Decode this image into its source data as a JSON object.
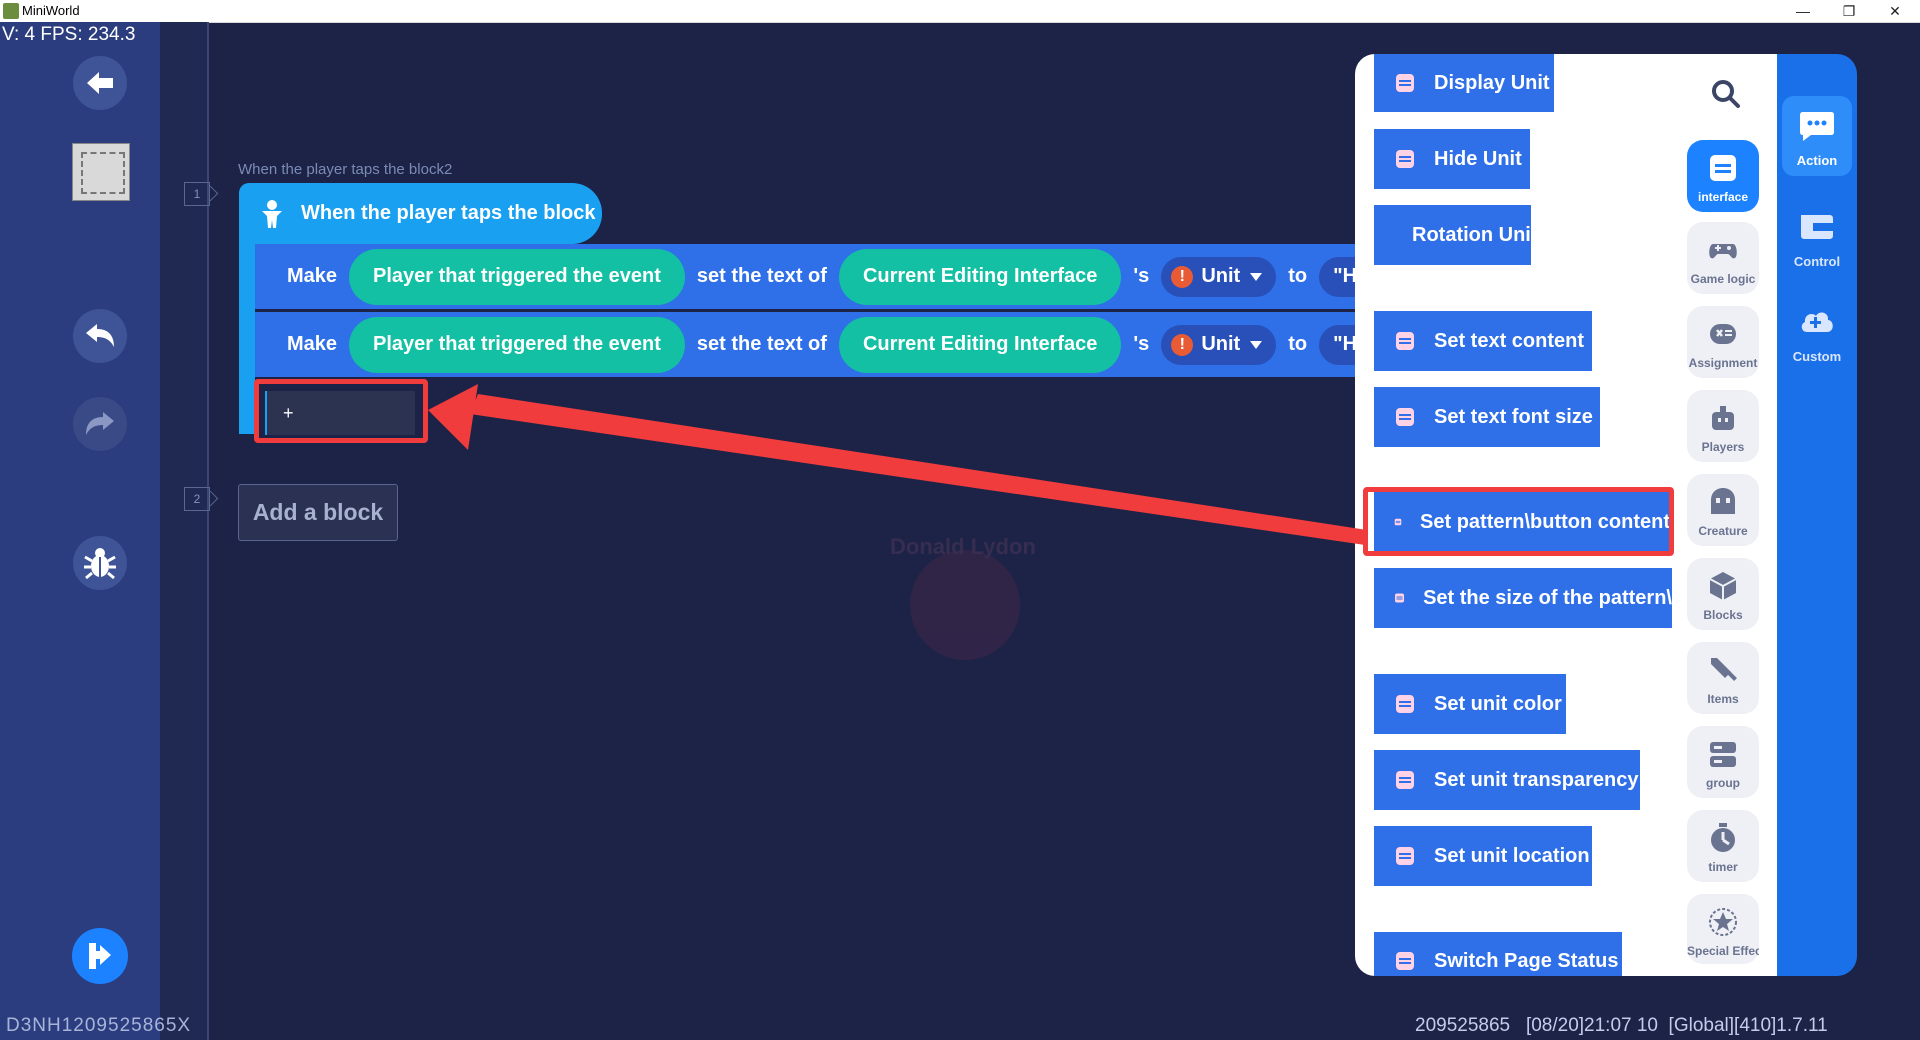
{
  "window": {
    "title": "MiniWorld",
    "minimize": "—",
    "maximize": "❐",
    "close": "✕"
  },
  "hud": {
    "fps": "V: 4 FPS: 234.3",
    "bottom_left": "D3NH1209525865X",
    "bottom_right": "209525865   [08/20]21:07 10  [Global][410]1.7.11"
  },
  "left_toolbar": {
    "icons": [
      "back-arrow-icon",
      "map-thumbnail",
      "undo-icon",
      "redo-icon",
      "bug-icon",
      "run-icon"
    ]
  },
  "watermark": {
    "text": "Donald Lydon"
  },
  "script": {
    "event_label": "When the player taps the block2",
    "line1": "1",
    "line2": "2",
    "event_block": "When the player taps the block",
    "rows": [
      {
        "make": "Make",
        "player": "Player that triggered the event",
        "set_text": "set the text of",
        "interface": "Current Editing Interface",
        "poss": "'s",
        "unit": "Unit",
        "to": "to",
        "value": "\"Hell"
      },
      {
        "make": "Make",
        "player": "Player that triggered the event",
        "set_text": "set the text of",
        "interface": "Current Editing Interface",
        "poss": "'s",
        "unit": "Unit",
        "to": "to",
        "value": "\"Hell"
      }
    ],
    "add_slot": "+",
    "add_block": "Add a block"
  },
  "block_list": {
    "items": [
      "Display Unit",
      "Hide Unit",
      "Rotation Unit",
      "Set text content",
      "Set text font size",
      "Set pattern\\button content",
      "Set the size of the pattern\\",
      "Set unit color",
      "Set unit transparency",
      "Set unit location",
      "Switch Page Status"
    ]
  },
  "categories": [
    {
      "label": "interface",
      "icon": "interface-icon",
      "active": true
    },
    {
      "label": "Game logic",
      "icon": "gamepad-icon"
    },
    {
      "label": "Assignment",
      "icon": "assignment-icon"
    },
    {
      "label": "Players",
      "icon": "player-icon"
    },
    {
      "label": "Creature",
      "icon": "creature-icon"
    },
    {
      "label": "Blocks",
      "icon": "cube-icon"
    },
    {
      "label": "Items",
      "icon": "sword-icon"
    },
    {
      "label": "group",
      "icon": "group-icon"
    },
    {
      "label": "timer",
      "icon": "timer-icon"
    },
    {
      "label": "Special Effect",
      "icon": "star-icon"
    }
  ],
  "nav": [
    {
      "label": "Action",
      "icon": "chat-bubble-icon",
      "active": true
    },
    {
      "label": "Control",
      "icon": "control-icon"
    },
    {
      "label": "Custom",
      "icon": "custom-icon"
    }
  ],
  "colors": {
    "accent": "#1c82ff",
    "action_block": "#2f6fe8",
    "event_block": "#1aa0f0",
    "pill_green": "#13c0a3",
    "highlight": "#f03c3c"
  }
}
